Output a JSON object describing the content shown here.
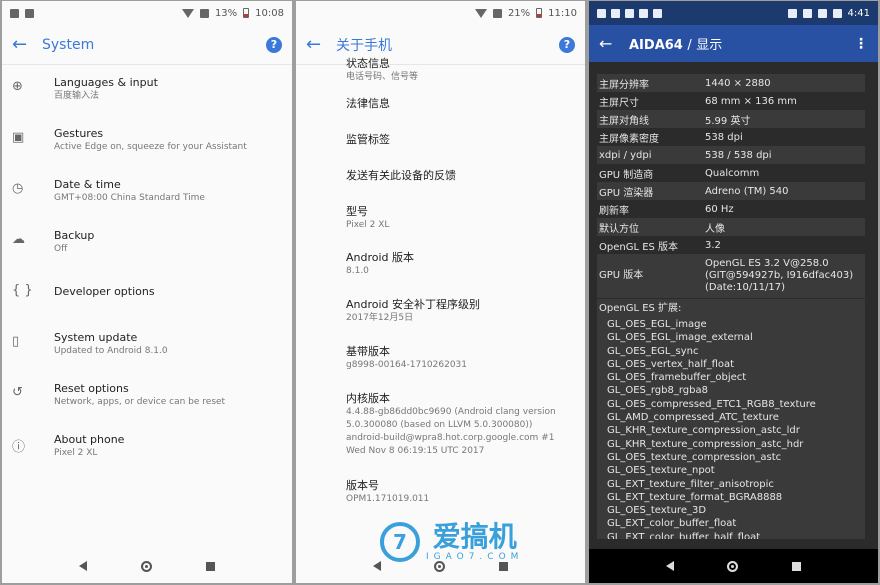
{
  "panel_left": {
    "status": {
      "battery": "13%",
      "time": "10:08"
    },
    "toolbar": {
      "title": "System",
      "help": "?"
    },
    "items": [
      {
        "icon": "globe-icon",
        "glyph": "⊕",
        "title": "Languages & input",
        "subtitle": "百度输入法"
      },
      {
        "icon": "gestures-icon",
        "glyph": "▣",
        "title": "Gestures",
        "subtitle": "Active Edge on, squeeze for your Assistant"
      },
      {
        "icon": "clock-icon",
        "glyph": "◷",
        "title": "Date & time",
        "subtitle": "GMT+08:00 China Standard Time"
      },
      {
        "icon": "cloud-upload-icon",
        "glyph": "☁",
        "title": "Backup",
        "subtitle": "Off"
      },
      {
        "icon": "code-braces-icon",
        "glyph": "{ }",
        "title": "Developer options",
        "subtitle": ""
      },
      {
        "icon": "system-update-icon",
        "glyph": "▯",
        "title": "System update",
        "subtitle": "Updated to Android 8.1.0"
      },
      {
        "icon": "restore-icon",
        "glyph": "↺",
        "title": "Reset options",
        "subtitle": "Network, apps, or device can be reset"
      },
      {
        "icon": "info-icon",
        "glyph": "ⓘ",
        "title": "About phone",
        "subtitle": "Pixel 2 XL"
      }
    ]
  },
  "panel_middle": {
    "status": {
      "battery": "21%",
      "time": "11:10"
    },
    "toolbar": {
      "title": "关于手机",
      "help": "?"
    },
    "top_partial": {
      "title": "状态信息",
      "subtitle": "电话号码、信号等"
    },
    "items": [
      {
        "title": "法律信息",
        "subtitle": ""
      },
      {
        "title": "监管标签",
        "subtitle": ""
      },
      {
        "title": "发送有关此设备的反馈",
        "subtitle": ""
      },
      {
        "title": "型号",
        "subtitle": "Pixel 2 XL"
      },
      {
        "title": "Android 版本",
        "subtitle": "8.1.0"
      },
      {
        "title": "Android 安全补丁程序级别",
        "subtitle": "2017年12月5日"
      },
      {
        "title": "基带版本",
        "subtitle": "g8998-00164-1710262031"
      },
      {
        "title": "内核版本",
        "subtitle": "4.4.88-gb86dd0bc9690 (Android clang version 5.0.300080 (based on LLVM 5.0.300080))\nandroid-build@wpra8.hot.corp.google.com #1\nWed Nov 8 06:19:15 UTC 2017"
      },
      {
        "title": "版本号",
        "subtitle": "OPM1.171019.011"
      }
    ]
  },
  "panel_right": {
    "status": {
      "time": "4:41"
    },
    "toolbar": {
      "app": "AIDA64",
      "separator": "/",
      "section": "显示",
      "menu": "⋮"
    },
    "rows": [
      {
        "key": "主屏分辨率",
        "value": "1440 × 2880"
      },
      {
        "key": "主屏尺寸",
        "value": "68 mm × 136 mm"
      },
      {
        "key": "主屏对角线",
        "value": "5.99 英寸"
      },
      {
        "key": "主屏像素密度",
        "value": "538 dpi"
      },
      {
        "key": "xdpi / ydpi",
        "value": "538 / 538 dpi"
      },
      {
        "key": "GPU 制造商",
        "value": "Qualcomm"
      },
      {
        "key": "GPU 渲染器",
        "value": "Adreno (TM) 540"
      },
      {
        "key": "刷新率",
        "value": "60 Hz"
      },
      {
        "key": "默认方位",
        "value": "人像"
      },
      {
        "key": "OpenGL ES 版本",
        "value": "3.2"
      },
      {
        "key": "GPU 版本",
        "value": "OpenGL ES 3.2 V@258.0 (GIT@594927b, I916dfac403) (Date:10/11/17)"
      }
    ],
    "extensions_title": "OpenGL ES 扩展:",
    "extensions": [
      "GL_OES_EGL_image",
      "GL_OES_EGL_image_external",
      "GL_OES_EGL_sync",
      "GL_OES_vertex_half_float",
      "GL_OES_framebuffer_object",
      "GL_OES_rgb8_rgba8",
      "GL_OES_compressed_ETC1_RGB8_texture",
      "GL_AMD_compressed_ATC_texture",
      "GL_KHR_texture_compression_astc_ldr",
      "GL_KHR_texture_compression_astc_hdr",
      "GL_OES_texture_compression_astc",
      "GL_OES_texture_npot",
      "GL_EXT_texture_filter_anisotropic",
      "GL_EXT_texture_format_BGRA8888",
      "GL_OES_texture_3D",
      "GL_EXT_color_buffer_float",
      "GL_EXT_color_buffer_half_float"
    ]
  },
  "watermark": {
    "logo": "7",
    "main": "爱搞机",
    "sub": "IGAO7.COM"
  },
  "colors": {
    "accent": "#3b78d8",
    "aida_bar": "#2851a3",
    "aida_status": "#1c3a6e",
    "watermark": "#3aa0db"
  }
}
